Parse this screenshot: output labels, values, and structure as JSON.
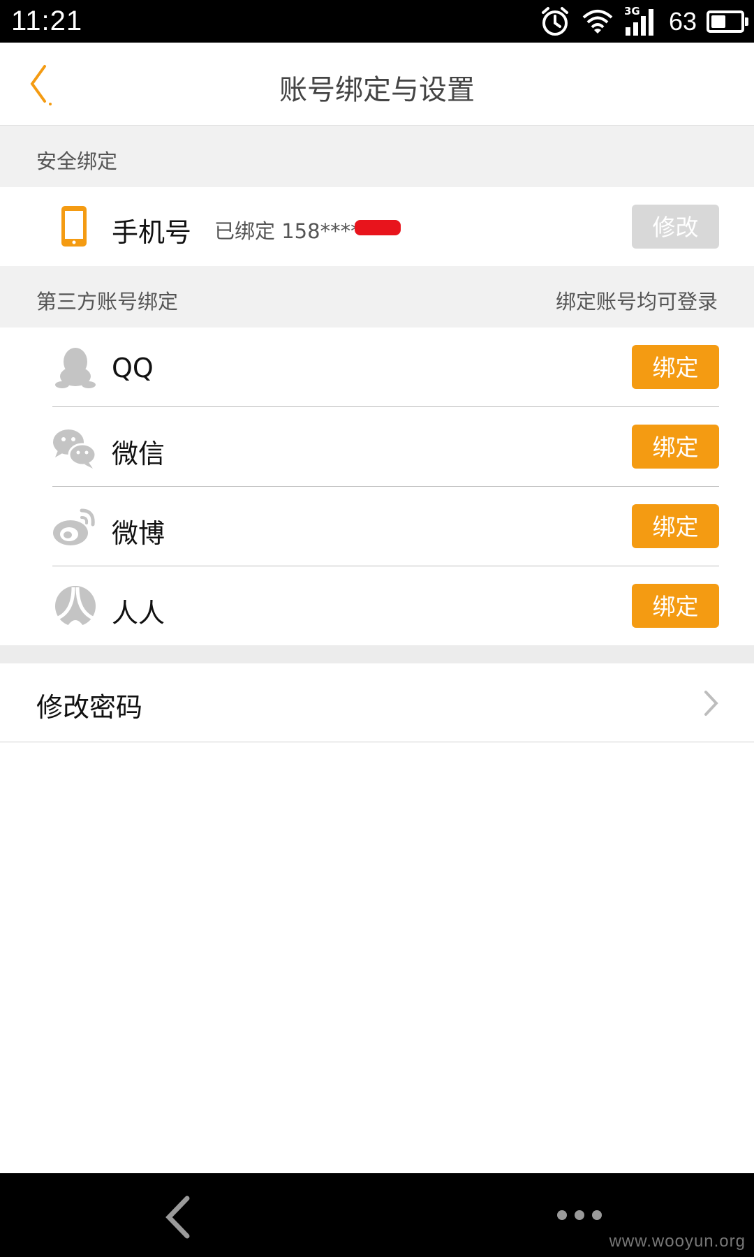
{
  "status_bar": {
    "time": "11:21",
    "network": "3G",
    "battery_percent": "63"
  },
  "header": {
    "title": "账号绑定与设置",
    "back_icon": "chevron-left-icon"
  },
  "security_section": {
    "title": "安全绑定",
    "phone": {
      "label": "手机号",
      "status": "已绑定 158****",
      "button": "修改",
      "icon": "phone-icon"
    }
  },
  "third_party_section": {
    "title": "第三方账号绑定",
    "hint": "绑定账号均可登录",
    "items": [
      {
        "label": "QQ",
        "button": "绑定",
        "icon": "qq-icon"
      },
      {
        "label": "微信",
        "button": "绑定",
        "icon": "wechat-icon"
      },
      {
        "label": "微博",
        "button": "绑定",
        "icon": "weibo-icon"
      },
      {
        "label": "人人",
        "button": "绑定",
        "icon": "renren-icon"
      }
    ]
  },
  "password": {
    "label": "修改密码",
    "icon": "chevron-right-icon"
  },
  "navbar": {
    "back_icon": "nav-back-icon",
    "more_icon": "more-dots-icon"
  },
  "watermark": "www.wooyun.org",
  "colors": {
    "accent": "#f49b12",
    "disabled_button": "#d8d8d8",
    "section_bg": "#f1f1f1"
  }
}
